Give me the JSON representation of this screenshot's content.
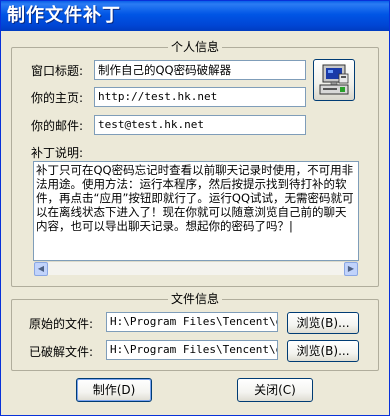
{
  "window": {
    "title": "制作文件补丁"
  },
  "personal": {
    "group_title": "个人信息",
    "window_title_label": "窗口标题:",
    "window_title_value": "制作自己的QQ密码破解器",
    "homepage_label": "你的主页:",
    "homepage_value": "http://test.hk.net",
    "email_label": "你的邮件:",
    "email_value": "test@test.hk.net",
    "desc_label": "补丁说明:",
    "description": "补丁只可在QQ密码忘记时查看以前聊天记录时使用，不可用非法用途。使用方法：运行本程序，然后按提示找到待打补的软件，再点击“应用”按钮即就行了。运行QQ试试，无需密码就可以在离线状态下进入了！现在你就可以随意浏览自己前的聊天内容，也可以导出聊天记录。想起你的密码了吗？|"
  },
  "fileinfo": {
    "group_title": "文件信息",
    "original_label": "原始的文件:",
    "original_value": "H:\\Program Files\\Tencent\\qq\\",
    "cracked_label": "已破解文件:",
    "cracked_value": "H:\\Program Files\\Tencent\\qq\\",
    "browse_label_1": "浏览(B)...",
    "browse_label_2": "浏览(B)..."
  },
  "buttons": {
    "make_label": "制作(D)",
    "close_label": "关闭(C)"
  },
  "icons": {
    "app_icon": "computer-icon"
  },
  "colors": {
    "titlebar": "#0055e5",
    "face": "#ece9d8",
    "field_border": "#7f9db9"
  }
}
